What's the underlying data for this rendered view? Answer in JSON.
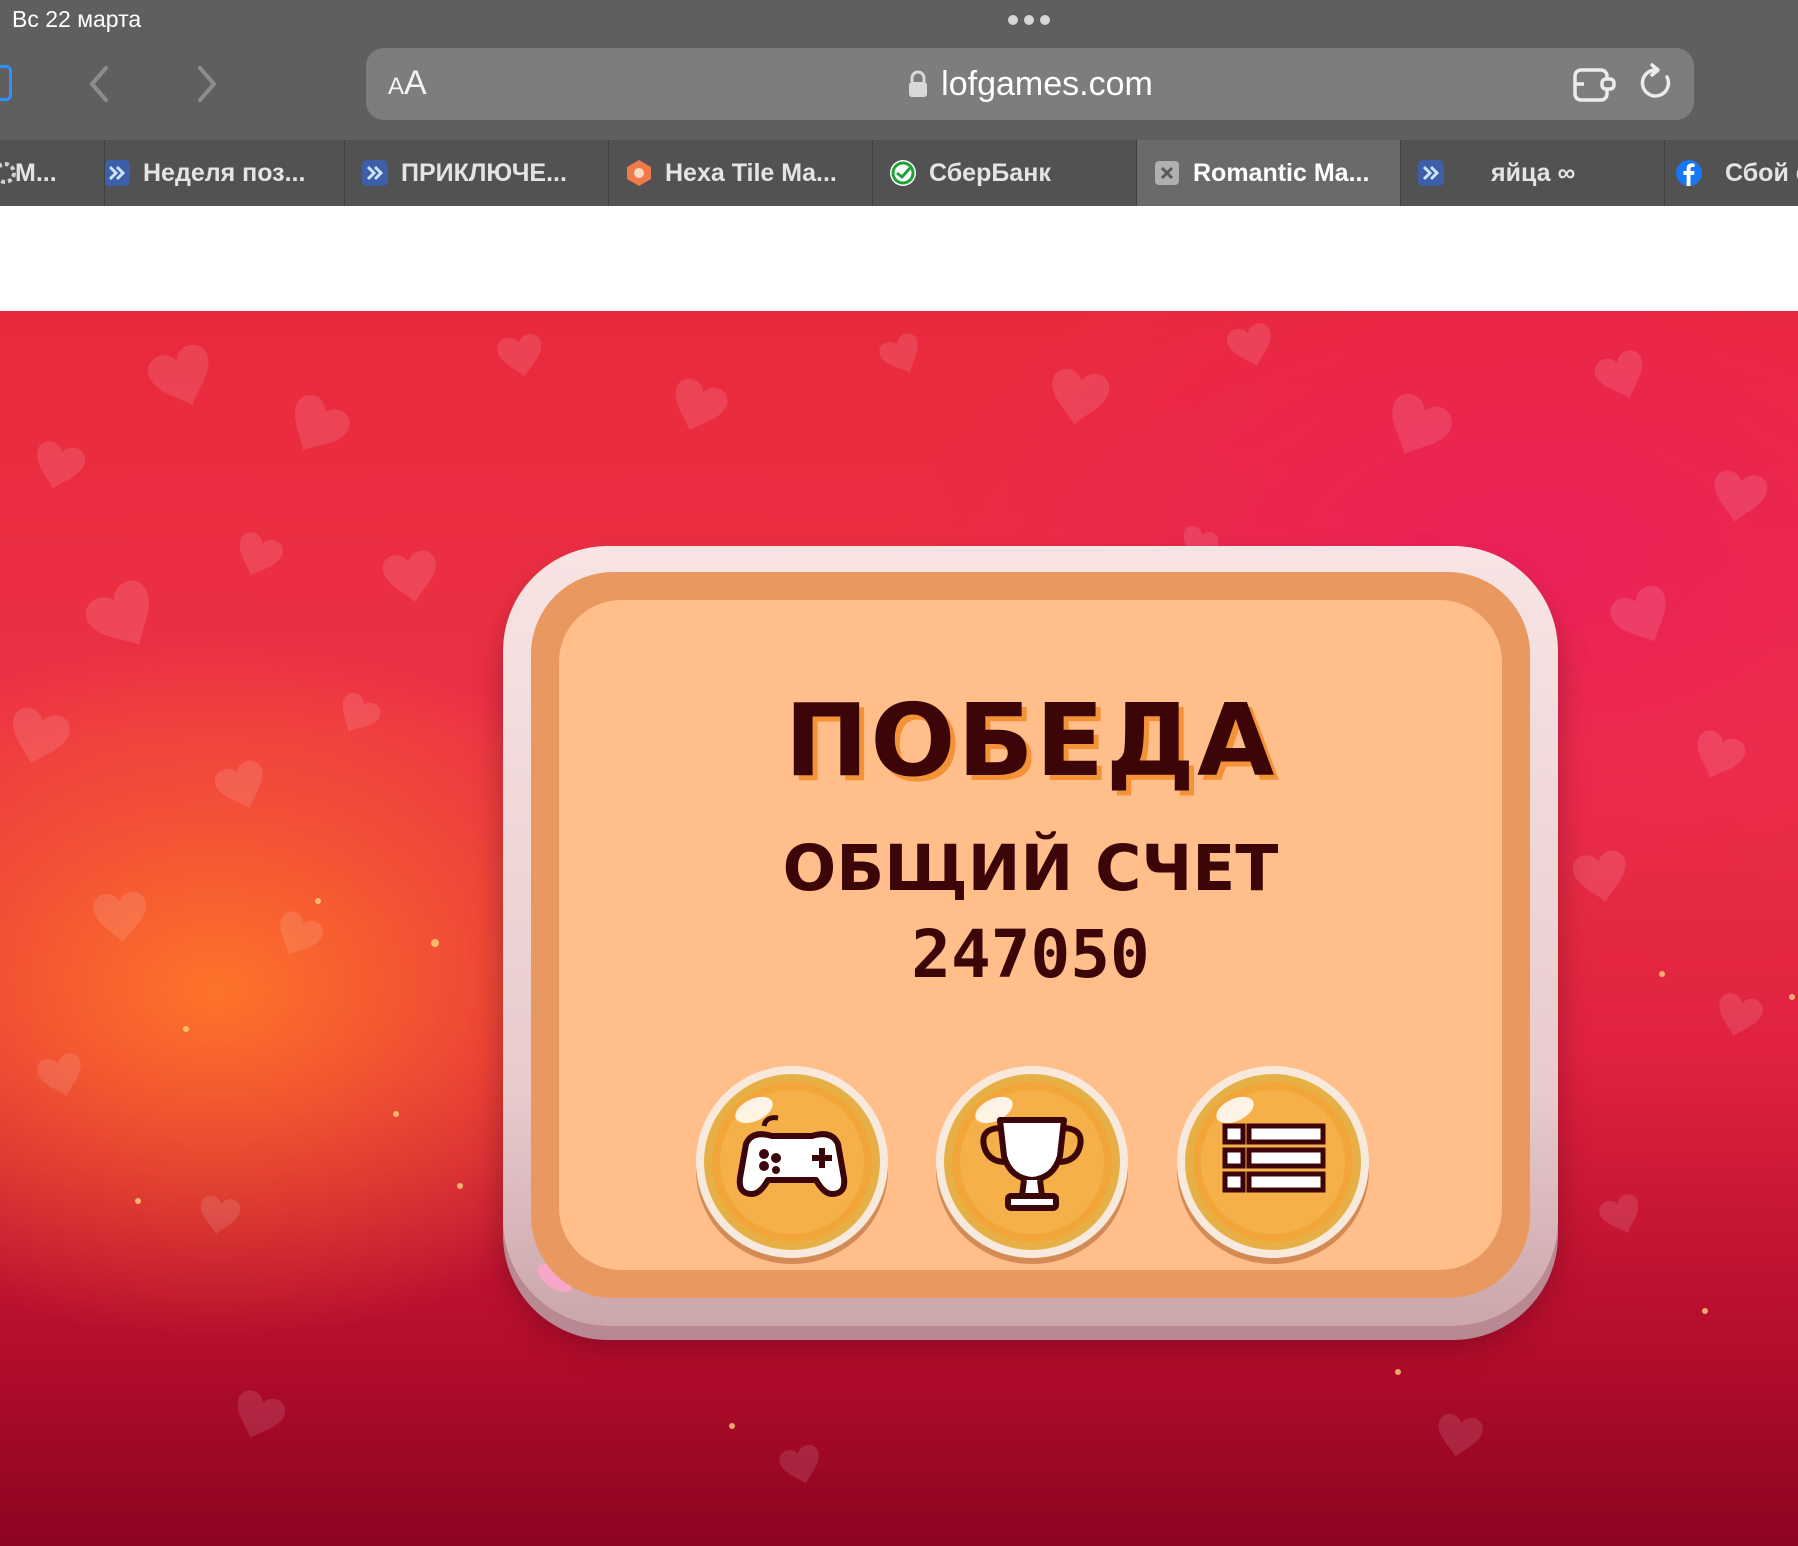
{
  "status_bar": {
    "date": "Вс 22 марта"
  },
  "address_bar": {
    "text_size_small": "A",
    "text_size_large": "A",
    "url": "lofgames.com"
  },
  "tabs": [
    {
      "label": "М...",
      "icon": "gear-icon"
    },
    {
      "label": "Неделя поз...",
      "icon": "blue-arrows-icon"
    },
    {
      "label": "ПРИКЛЮЧЕ...",
      "icon": "blue-arrows-icon"
    },
    {
      "label": "Hexa Tile Ma...",
      "icon": "hexagon-icon"
    },
    {
      "label": "СберБанк",
      "icon": "sber-icon"
    },
    {
      "label": "Romantic Ma...",
      "icon": "close-icon",
      "active": true
    },
    {
      "label": "яйца ∞",
      "icon": "blue-arrows-icon"
    },
    {
      "label": "Сбой с",
      "icon": "facebook-icon"
    }
  ],
  "game": {
    "title": "ПОБЕДА",
    "score_label": "ОБЩИЙ СЧЕТ",
    "score_value": "247050",
    "buttons": [
      {
        "name": "play",
        "icon": "gamepad-icon"
      },
      {
        "name": "trophy",
        "icon": "trophy-icon"
      },
      {
        "name": "levels",
        "icon": "list-icon"
      }
    ]
  },
  "colors": {
    "chrome_bg": "#5f5f60",
    "address_bar_bg": "#7d7d7e",
    "active_tab_bg": "#6a6a6b",
    "game_bg": "#e92a3c",
    "dialog_fill": "#ffbe8a",
    "dialog_rim": "#e99860",
    "title_text": "#3c0609",
    "title_shadow": "#f49236",
    "button_gold": "#f2a63a"
  }
}
